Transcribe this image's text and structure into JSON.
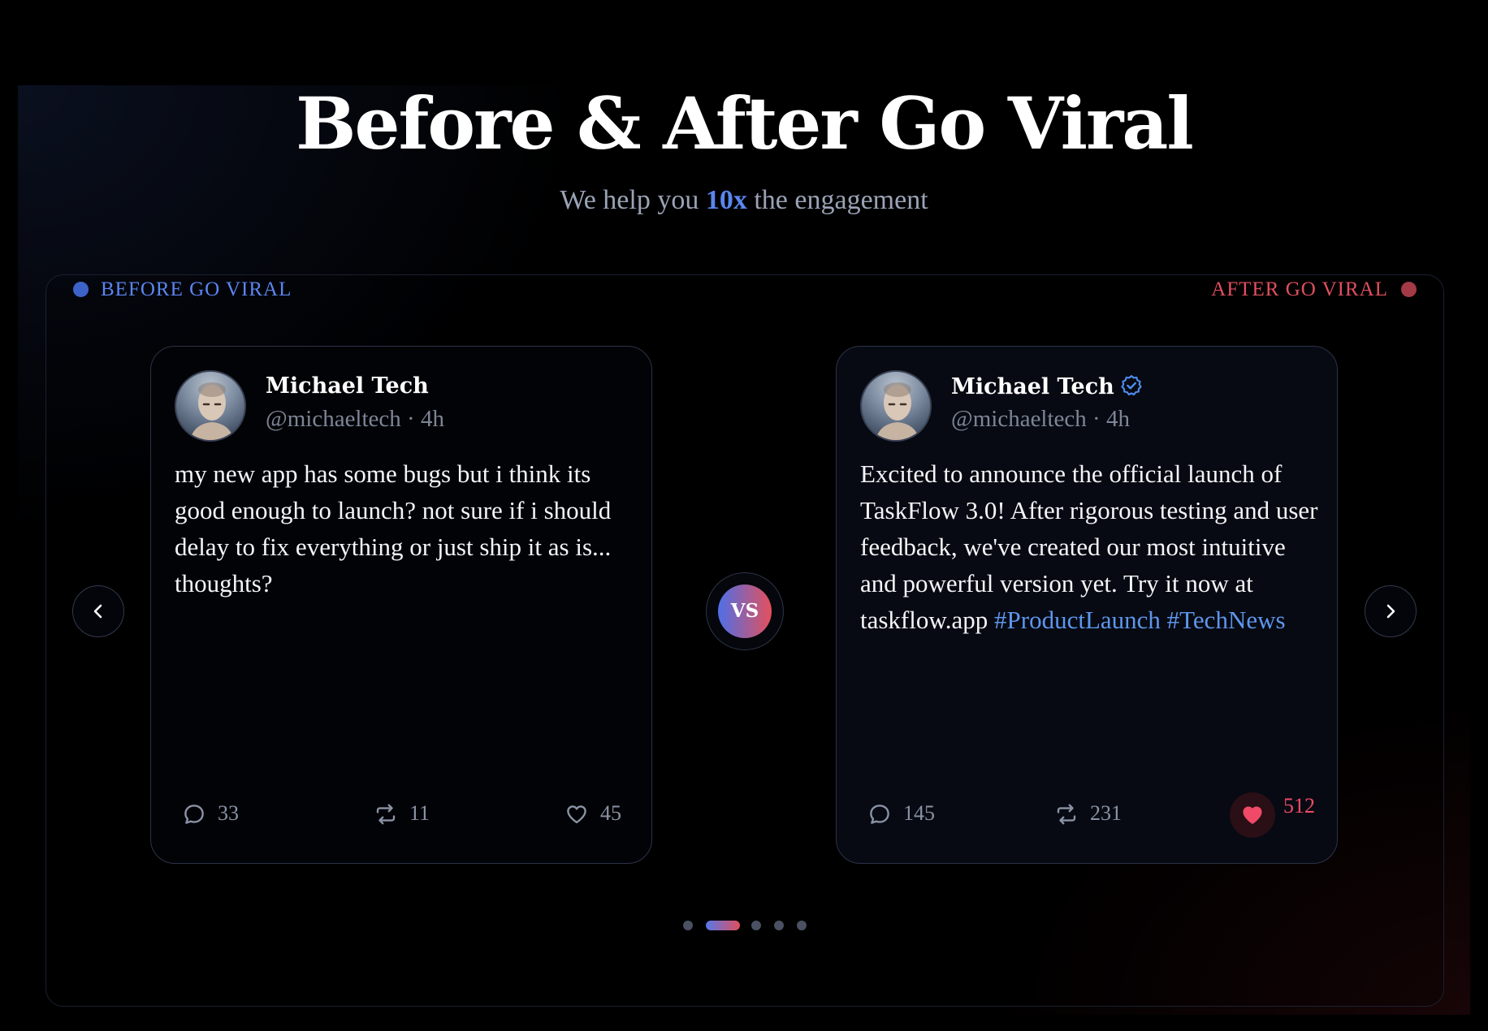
{
  "hero": {
    "title": "Before & After Go Viral",
    "subtitle_pre": "We help you ",
    "subtitle_accent": "10x",
    "subtitle_post": " the engagement"
  },
  "labels": {
    "before": "BEFORE GO VIRAL",
    "after": "AFTER GO VIRAL"
  },
  "colors": {
    "accent_blue": "#5b86f0",
    "accent_red": "#e0505e",
    "hashtag": "#5e96ee",
    "like_active": "#f04a68"
  },
  "vs_label": "VS",
  "before_post": {
    "name": "Michael Tech",
    "handle": "@michaeltech · 4h",
    "text": "my new app has some bugs but i think its good enough to launch? not sure if i should delay to fix everything or just ship it as is... thoughts?",
    "replies": "33",
    "reposts": "11",
    "likes": "45",
    "verified": false,
    "liked": false
  },
  "after_post": {
    "name": "Michael Tech",
    "handle": "@michaeltech · 4h",
    "text": "Excited to announce the official launch of TaskFlow 3.0! After rigorous testing and user feedback, we've created our most intuitive and powerful version yet. Try it now at taskflow.app ",
    "hashtag_1": "#ProductLaunch",
    "hashtag_2": "#TechNews",
    "replies": "145",
    "reposts": "231",
    "likes": "512",
    "verified": true,
    "liked": true
  },
  "pagination": {
    "total": 5,
    "active_index": 1
  },
  "icons": {
    "prev": "chevron-left-icon",
    "next": "chevron-right-icon",
    "reply": "comment-icon",
    "repost": "repost-icon",
    "like": "heart-icon",
    "verified": "verified-badge-icon"
  }
}
